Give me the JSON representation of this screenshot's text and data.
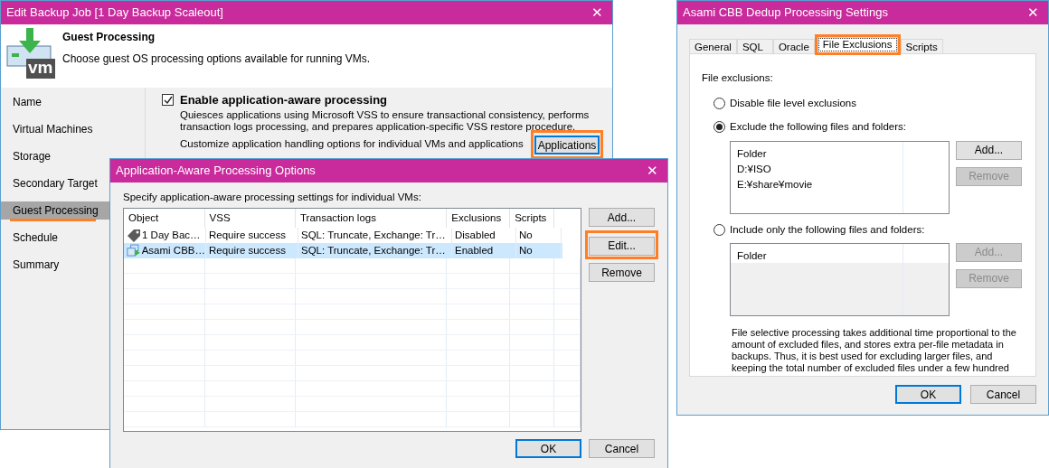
{
  "backup_window": {
    "title": "Edit Backup Job [1 Day Backup Scaleout]",
    "close": "✕",
    "logo_text": "vm",
    "header_title": "Guest Processing",
    "header_subtitle": "Choose guest OS processing options available for running VMs.",
    "steps": [
      {
        "label": "Name",
        "selected": false,
        "highlighted": false
      },
      {
        "label": "Virtual Machines",
        "selected": false,
        "highlighted": false
      },
      {
        "label": "Storage",
        "selected": false,
        "highlighted": false
      },
      {
        "label": "Secondary Target",
        "selected": false,
        "highlighted": false
      },
      {
        "label": "Guest Processing",
        "selected": true,
        "highlighted": true
      },
      {
        "label": "Schedule",
        "selected": false,
        "highlighted": false
      },
      {
        "label": "Summary",
        "selected": false,
        "highlighted": false
      }
    ],
    "app_aware": {
      "label": "Enable application-a**w**are processing",
      "checked": true,
      "description": "Quiesces applications using Microsoft VSS to ensure transactional consistency, performs transaction logs processing, and prepares application-specific VSS restore procedure.",
      "customize_text": "Customize application handling options for individual VMs and applications",
      "button": {
        "label": "Applications",
        "highlighted": true,
        "default": true
      }
    }
  },
  "app_window": {
    "title": "Application-Aware Processing Options",
    "close": "✕",
    "intro": "Specify application-aware processing settings for individual VMs:",
    "columns": [
      "Object",
      "VSS",
      "Transaction logs",
      "Exclusions",
      "Scripts"
    ],
    "rows": [
      {
        "kind": "tag",
        "cells": [
          "1 Day Bac…",
          "Require success",
          "SQL: Truncate, Exchange: Tr…",
          "Disabled",
          "No"
        ],
        "selected": false
      },
      {
        "kind": "vm",
        "cells": [
          "Asami CBB…",
          "Require success",
          "SQL: Truncate, Exchange: Tr…",
          "Enabled",
          "No"
        ],
        "selected": true
      }
    ],
    "side_buttons": [
      {
        "label": "Add...",
        "highlighted": false
      },
      {
        "label": "Edit...",
        "highlighted": true
      },
      {
        "label": "Remove",
        "highlighted": false
      }
    ],
    "footer_buttons": [
      {
        "label": "OK",
        "default": true
      },
      {
        "label": "Cancel",
        "default": false
      }
    ]
  },
  "dedup_window": {
    "title": "Asami CBB Dedup Processing Settings",
    "close": "✕",
    "tabs": [
      {
        "label": "General",
        "selected": false,
        "highlighted": false
      },
      {
        "label": "SQL",
        "selected": false,
        "highlighted": false
      },
      {
        "label": "Oracle",
        "selected": false,
        "highlighted": false
      },
      {
        "label": "File Exclusions",
        "selected": true,
        "highlighted": true
      },
      {
        "label": "Scripts",
        "selected": false,
        "highlighted": false
      }
    ],
    "section_label": "File exclusions:",
    "options": [
      {
        "label": "Disable file level exclusions",
        "selected": false
      },
      {
        "label": "Exclude the following files and folders:",
        "selected": true,
        "list": {
          "header": "Folder",
          "items": [
            "D:¥ISO",
            "E:¥share¥movie"
          ],
          "disabled": false,
          "buttons": [
            {
              "label": "Add...",
              "disabled": false
            },
            {
              "label": "Remove",
              "disabled": true
            }
          ]
        }
      },
      {
        "label": "Include only the following files and folders:",
        "selected": false,
        "list": {
          "header": "Folder",
          "disabled": true,
          "buttons": [
            {
              "label": "Add...",
              "disabled": true
            },
            {
              "label": "Remove",
              "disabled": true
            }
          ]
        }
      }
    ],
    "note": "File selective processing takes additional time proportional to the amount of excluded files, and stores extra per-file metadata in backups. Thus, it is best used for excluding larger files, and keeping the total number of excluded files under a few hundred",
    "footer_buttons": [
      {
        "label": "OK",
        "default": true
      },
      {
        "label": "Cancel",
        "default": false
      }
    ]
  }
}
